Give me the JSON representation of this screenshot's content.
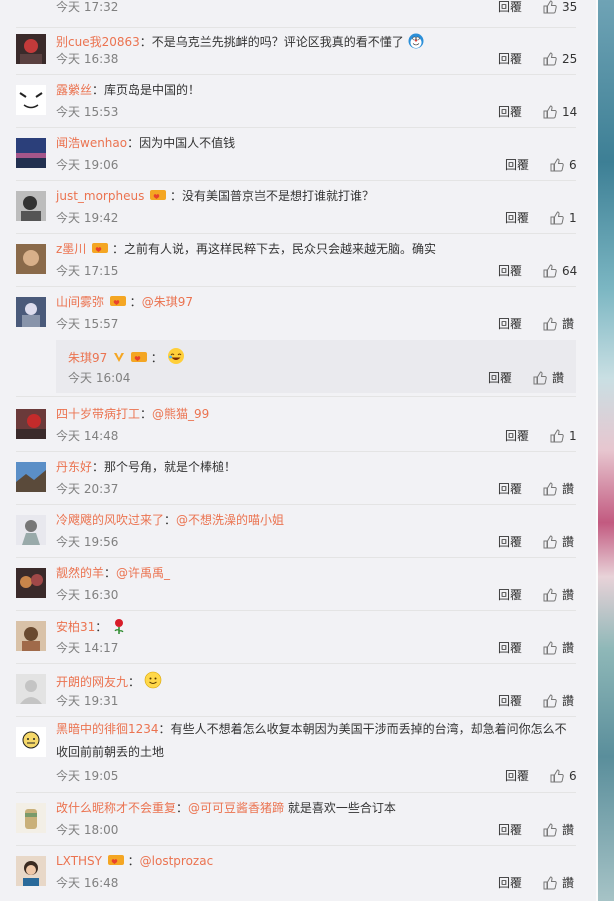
{
  "actions": {
    "reply_label": "回覆",
    "like_zero": "讚"
  },
  "comments": [
    {
      "user": "",
      "sep": "",
      "text": "",
      "time": "今天 17:32",
      "likes": "35"
    },
    {
      "user": "别cue我20863",
      "sep": "：",
      "text": "不是乌克兰先挑衅的吗？评论区我真的看不懂了",
      "emoji": "doraemon-emoji",
      "time": "今天 16:38",
      "likes": "25"
    },
    {
      "user": "露縈丝",
      "sep": "：",
      "text": "库页岛是中国的！",
      "time": "今天 15:53",
      "likes": "14"
    },
    {
      "user": "闻浩wenhao",
      "sep": "：",
      "text": "因为中国人不值钱",
      "time": "今天 19:06",
      "likes": "6"
    },
    {
      "user": "just_morpheus",
      "sep": "：",
      "text": "没有美国普京岂不是想打谁就打谁？",
      "time": "今天 19:42",
      "likes": "1"
    },
    {
      "user": "z墨川",
      "sep": "：",
      "text": "之前有人说，再这样民粹下去，民众只会越来越无脑。确实",
      "time": "今天 17:15",
      "likes": "64"
    },
    {
      "user": "山间雾弥",
      "sep": "：",
      "mention": "@朱琪97",
      "time": "今天 15:57",
      "likes": "讚"
    },
    {
      "user": "四十岁带病打工",
      "sep": "：",
      "mention": "@熊猫_99",
      "time": "今天 14:48",
      "likes": "1"
    },
    {
      "user": "丹东好",
      "sep": "：",
      "text": "那个号角，就是个棒槌！",
      "time": "今天 20:37",
      "likes": "讚"
    },
    {
      "user": "冷飕飕的风吹过来了",
      "sep": "：",
      "mention": "@不想洗澡的喵小姐",
      "time": "今天 19:56",
      "likes": "讚"
    },
    {
      "user": "靓然的羊",
      "sep": "：",
      "mention": "@许禹禹_",
      "time": "今天 16:30",
      "likes": "讚"
    },
    {
      "user": "安柏31",
      "sep": "：",
      "emoji": "rose-emoji",
      "time": "今天 14:17",
      "likes": "讚"
    },
    {
      "user": "开朗的网友九",
      "sep": "：",
      "emoji": "smile-emoji",
      "time": "今天 19:31",
      "likes": "讚"
    },
    {
      "user": "黑暗中的徘徊1234",
      "sep": "：",
      "text": "有些人不想着怎么收复本朝因为美国干涉而丢掉的台湾，却急着问你怎么不收回前前朝丢的土地",
      "time": "今天 19:05",
      "likes": "6"
    },
    {
      "user": "改什么昵称才不会重复",
      "sep": "：",
      "mention": "@可可豆酱香猪蹄",
      "text": " 就是喜欢一些合订本",
      "time": "今天 18:00",
      "likes": "讚"
    },
    {
      "user": "LXTHSY",
      "sep": "：",
      "mention": "@lostprozac",
      "time": "今天 16:48",
      "likes": "讚"
    }
  ],
  "nested_reply": {
    "user": "朱琪97",
    "sep": "：",
    "emoji": "laugh-emoji",
    "time": "今天 16:04",
    "likes": "讚"
  },
  "colors": {
    "username": "#eb7350",
    "time": "#808080",
    "background": "#f2f2f5"
  }
}
